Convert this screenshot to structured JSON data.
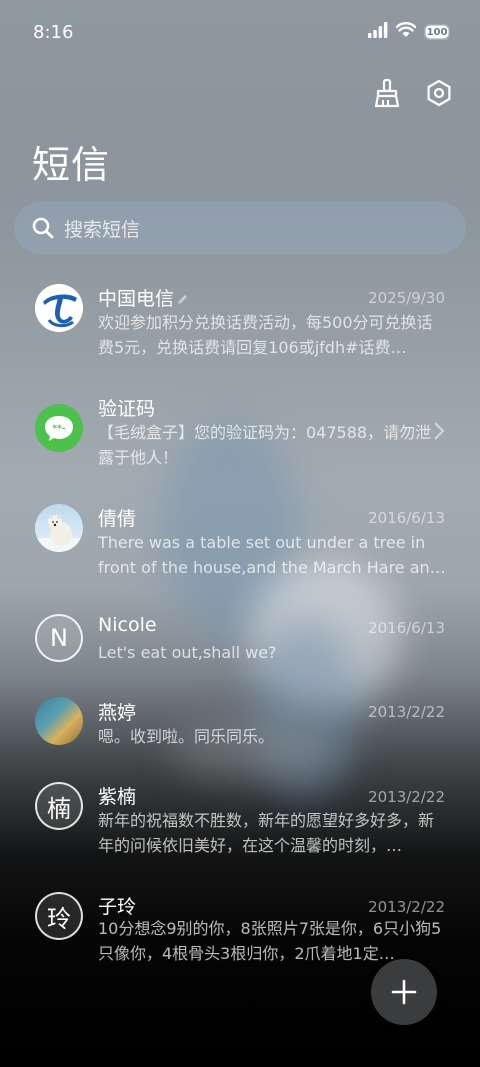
{
  "status": {
    "time": "8:16",
    "battery": "100"
  },
  "header": {
    "title": "短信"
  },
  "search": {
    "placeholder": "搜索短信"
  },
  "conversations": [
    {
      "name": "中国电信",
      "date": "2025/9/30",
      "preview": "欢迎参加积分兑换话费活动，每500分可兑换话费5元，兑换话费请回复106或jfdh#话费…",
      "avatar": "china-telecom-logo"
    },
    {
      "name": "验证码",
      "date": "",
      "preview": "【毛绒盒子】您的验证码为：047588，请勿泄露于他人！",
      "avatar": "message-code-icon"
    },
    {
      "name": "倩倩",
      "date": "2016/6/13",
      "preview": "There was a table set out under a tree in front of the house,and the March Hare an…",
      "avatar": "polar-bear-photo"
    },
    {
      "name": "Nicole",
      "date": "2016/6/13",
      "preview": "Let's eat out,shall we?",
      "avatar_letter": "N"
    },
    {
      "name": "燕婷",
      "date": "2013/2/22",
      "preview": "嗯。收到啦。同乐同乐。",
      "avatar": "landscape-photo"
    },
    {
      "name": "紫楠",
      "date": "2013/2/22",
      "preview": "新年的祝福数不胜数，新年的愿望好多好多，新年的问候依旧美好，在这个温馨的时刻，…",
      "avatar_letter": "楠"
    },
    {
      "name": "子玲",
      "date": "2013/2/22",
      "preview": "10分想念9别的你，8张照片7张是你，6只小狗5只像你，4根骨头3根归你，2爪着地1定…",
      "avatar_letter": "玲"
    }
  ],
  "colors": {
    "telecom_blue": "#1c5fb8",
    "code_green": "#4cc14c",
    "fab_bg": "#3b3c3e"
  }
}
